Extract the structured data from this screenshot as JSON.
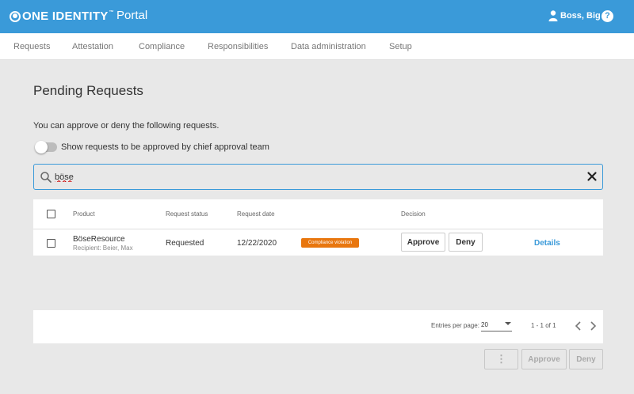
{
  "header": {
    "brand": "ONE IDENTITY",
    "app_title": "Portal",
    "user_name": "Boss, Big",
    "help": "?"
  },
  "nav": {
    "items": [
      "Requests",
      "Attestation",
      "Compliance",
      "Responsibilities",
      "Data administration",
      "Setup"
    ]
  },
  "page": {
    "title": "Pending Requests",
    "intro": "You can approve or deny the following requests.",
    "toggle_label": "Show requests to be approved by chief approval team",
    "toggle_on": false
  },
  "search": {
    "value": "böse",
    "placeholder": ""
  },
  "table": {
    "columns": {
      "product": "Product",
      "status": "Request status",
      "date": "Request date",
      "decision": "Decision"
    },
    "rows": [
      {
        "product": "BöseResource",
        "recipient": "Recipient: Beier, Max",
        "status": "Requested",
        "date": "12/22/2020",
        "badge": "Compliance violation",
        "approve_label": "Approve",
        "deny_label": "Deny",
        "details_label": "Details"
      }
    ]
  },
  "pager": {
    "entries_label": "Entries per page:",
    "entries_value": "20",
    "range": "1 - 1 of 1"
  },
  "actions": {
    "more_label": "⋮",
    "approve_label": "Approve",
    "deny_label": "Deny"
  },
  "colors": {
    "accent": "#3a9ad9",
    "badge": "#e8760e",
    "background": "#e8e8e8"
  }
}
